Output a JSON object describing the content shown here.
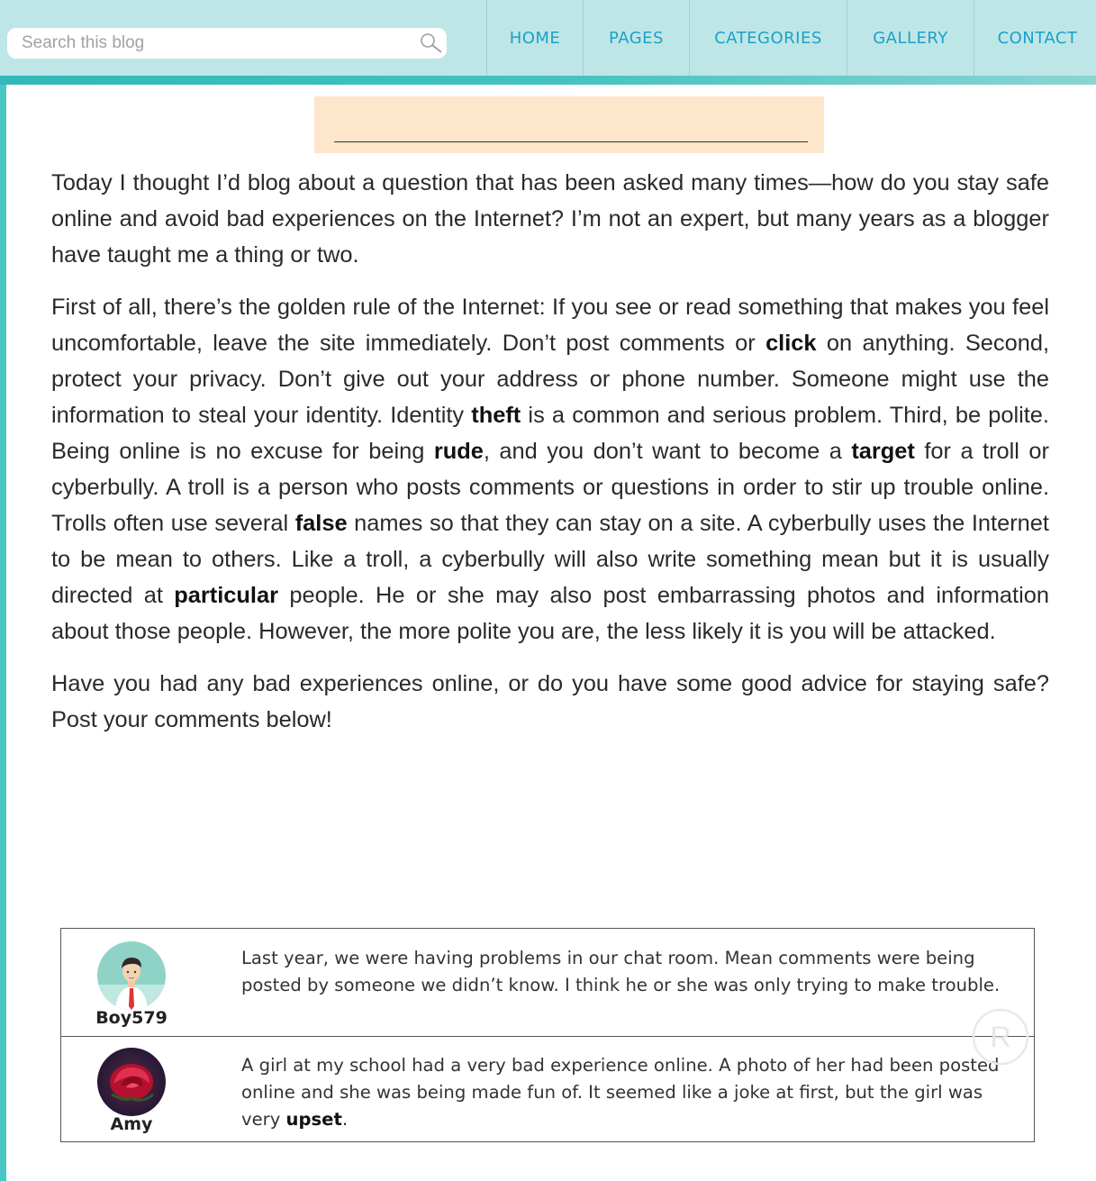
{
  "search": {
    "placeholder": "Search this blog"
  },
  "nav": [
    "HOME",
    "PAGES",
    "CATEGORIES",
    "GALLERY",
    "CONTACT"
  ],
  "title": "",
  "article": {
    "p1": "Today I thought I’d blog about a question that has been asked many times—how do you stay safe online and avoid bad experiences on the Internet? I’m not an expert, but many years as a blogger have taught me a thing or two.",
    "p2": [
      "First of all, there’s the golden rule of the Internet: If you see or read something that makes you feel uncomfortable, leave the site immediately. Don’t post comments or ",
      {
        "b": "click"
      },
      " on anything. Second, protect your privacy. Don’t give out your address or phone number. Someone might use the information to steal your identity. Identity ",
      {
        "b": "theft"
      },
      " is a common and serious problem. Third, be polite. Being online is no excuse for being ",
      {
        "b": "rude"
      },
      ", and you don’t want to become a ",
      {
        "b": "target"
      },
      " for a troll or cyberbully. A troll is a person who posts comments or questions in order to stir up trouble online. Trolls often use several ",
      {
        "b": "false"
      },
      " names so that they can stay on a site. A cyberbully uses the Internet to be mean to others. Like a troll, a cyberbully will also write something mean but it is usually directed at ",
      {
        "b": "particular"
      },
      " people. He or she may also post embarrassing photos and information about those people. However, the more polite you are, the less likely it is you will be attacked."
    ],
    "p3": "Have you had any bad experiences online, or do you have some good advice for staying safe? Post your comments below!"
  },
  "comments": [
    {
      "user": "Boy579",
      "avatar": "boy-avatar-icon",
      "text": [
        "Last year, we were having problems in our chat room. Mean comments were being posted by someone we didn’t know. I think he or she was only trying to make trouble."
      ]
    },
    {
      "user": "Amy",
      "avatar": "rose-avatar-icon",
      "text": [
        "A girl at my school had a very bad experience online. A photo of her had been posted online and she was being made fun of. It seemed like a joke at first, but the girl was very ",
        {
          "b": "upset"
        },
        "."
      ]
    }
  ],
  "colors": {
    "topbar": "#bfe6e7",
    "accent": "#1aa2c8",
    "stripe": "#2fb9b8",
    "title_box": "#fde6cc"
  }
}
